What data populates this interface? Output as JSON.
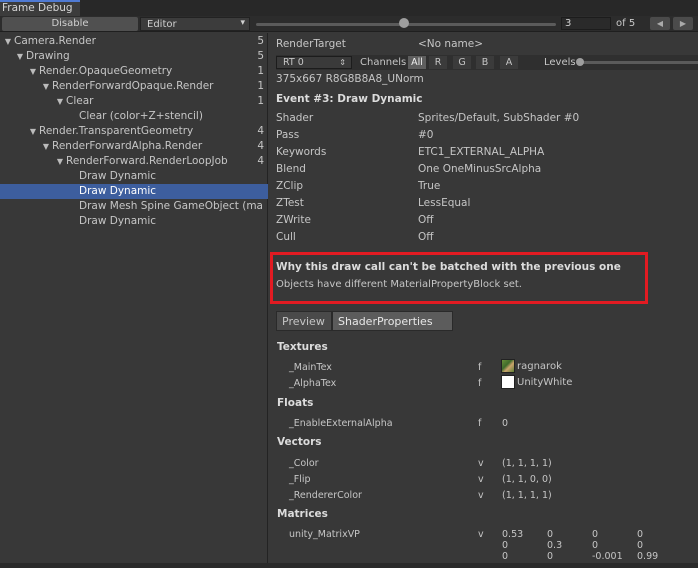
{
  "window": {
    "title": "Frame Debug"
  },
  "toolbar": {
    "disable_label": "Disable",
    "editor_label": "Editor",
    "current_event": "3",
    "of_total": "of 5",
    "prev_arrow": "◀",
    "next_arrow": "▶"
  },
  "tree": [
    {
      "label": "Camera.Render",
      "count": "5",
      "expanded": true
    },
    {
      "label": "Drawing",
      "count": "5",
      "expanded": true
    },
    {
      "label": "Render.OpaqueGeometry",
      "count": "1",
      "expanded": true
    },
    {
      "label": "RenderForwardOpaque.Render",
      "count": "1",
      "expanded": true
    },
    {
      "label": "Clear",
      "count": "1",
      "expanded": true
    },
    {
      "label": "Clear (color+Z+stencil)",
      "count": ""
    },
    {
      "label": "Render.TransparentGeometry",
      "count": "4",
      "expanded": true
    },
    {
      "label": "RenderForwardAlpha.Render",
      "count": "4",
      "expanded": true
    },
    {
      "label": "RenderForward.RenderLoopJob",
      "count": "4",
      "expanded": true
    },
    {
      "label": "Draw Dynamic",
      "count": ""
    },
    {
      "label": "Draw Dynamic",
      "count": "",
      "selected": true
    },
    {
      "label": "Draw Mesh Spine GameObject (ma",
      "count": ""
    },
    {
      "label": "Draw Dynamic",
      "count": ""
    }
  ],
  "render_target": {
    "label": "RenderTarget",
    "value": "<No name>"
  },
  "channels_bar": {
    "rt_label": "RT 0",
    "channels_label": "Channels",
    "buttons": [
      "All",
      "R",
      "G",
      "B",
      "A"
    ],
    "active": "All",
    "levels_label": "Levels",
    "format": "375x667 R8G8B8A8_UNorm"
  },
  "event": {
    "title": "Event #3: Draw Dynamic",
    "properties": [
      {
        "label": "Shader",
        "value": "Sprites/Default, SubShader #0"
      },
      {
        "label": "Pass",
        "value": "#0"
      },
      {
        "label": "Keywords",
        "value": "ETC1_EXTERNAL_ALPHA"
      },
      {
        "label": "Blend",
        "value": "One OneMinusSrcAlpha"
      },
      {
        "label": "ZClip",
        "value": "True"
      },
      {
        "label": "ZTest",
        "value": "LessEqual"
      },
      {
        "label": "ZWrite",
        "value": "Off"
      },
      {
        "label": "Cull",
        "value": "Off"
      }
    ]
  },
  "batch_warning": {
    "title": "Why this draw call can't be batched with the previous one",
    "message": "Objects have different MaterialPropertyBlock set.",
    "highlight_color": "#e21b22"
  },
  "tabs": {
    "preview": "Preview",
    "shader_properties": "ShaderProperties",
    "active": "ShaderProperties"
  },
  "shader_properties": {
    "textures_title": "Textures",
    "textures": [
      {
        "name": "_MainTex",
        "type": "f",
        "value": "ragnarok"
      },
      {
        "name": "_AlphaTex",
        "type": "f",
        "value": "UnityWhite"
      }
    ],
    "floats_title": "Floats",
    "floats": [
      {
        "name": "_EnableExternalAlpha",
        "type": "f",
        "value": "0"
      }
    ],
    "vectors_title": "Vectors",
    "vectors": [
      {
        "name": "_Color",
        "type": "v",
        "value": "(1, 1, 1, 1)"
      },
      {
        "name": "_Flip",
        "type": "v",
        "value": "(1, 1, 0, 0)"
      },
      {
        "name": "_RendererColor",
        "type": "v",
        "value": "(1, 1, 1, 1)"
      }
    ],
    "matrices_title": "Matrices",
    "matrices": [
      {
        "name": "unity_MatrixVP",
        "type": "v",
        "rows": [
          [
            "0.53",
            "0",
            "0",
            "0"
          ],
          [
            "0",
            "0.3",
            "0",
            "0"
          ],
          [
            "0",
            "0",
            "-0.001",
            "0.99"
          ]
        ]
      }
    ]
  },
  "icons": {
    "expand": "triangle-down-icon",
    "dropdown": "chevron-down-icon"
  }
}
